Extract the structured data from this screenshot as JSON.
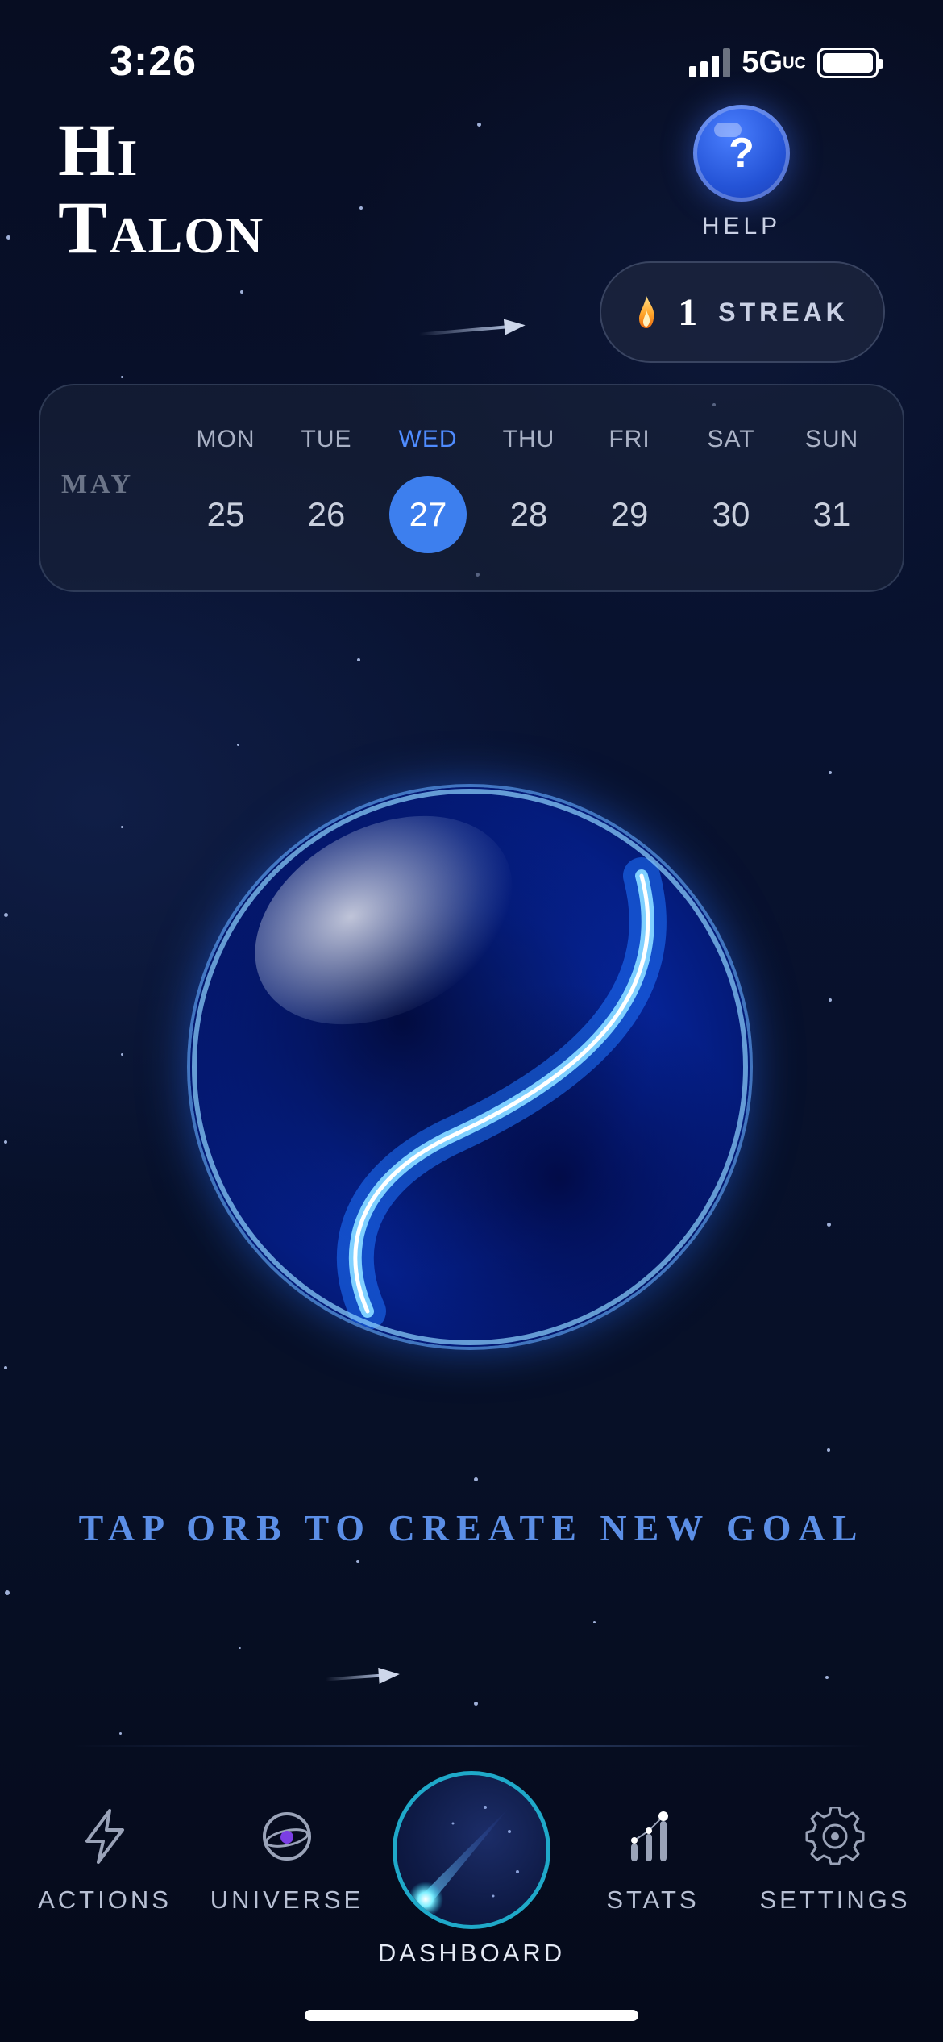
{
  "status_bar": {
    "time": "3:26",
    "network": "5G",
    "network_suffix": "UC"
  },
  "greeting": {
    "line1": "Hi",
    "line2": "Talon"
  },
  "help": {
    "icon_text": "?",
    "label": "HELP"
  },
  "streak": {
    "count": "1",
    "label": "STREAK"
  },
  "calendar": {
    "month": "MAY",
    "days": [
      {
        "dow": "MON",
        "num": "25"
      },
      {
        "dow": "TUE",
        "num": "26"
      },
      {
        "dow": "WED",
        "num": "27"
      },
      {
        "dow": "THU",
        "num": "28"
      },
      {
        "dow": "FRI",
        "num": "29"
      },
      {
        "dow": "SAT",
        "num": "30"
      },
      {
        "dow": "SUN",
        "num": "31"
      }
    ],
    "selected": "27"
  },
  "cta": "TAP ORB TO CREATE NEW GOAL",
  "nav": {
    "actions": "ACTIONS",
    "universe": "UNIVERSE",
    "dashboard": "DASHBOARD",
    "stats": "STATS",
    "settings": "SETTINGS"
  },
  "colors": {
    "accent": "#3d7fee",
    "cta": "#5b8ee6",
    "dashboard_ring": "#1fa9c9"
  }
}
